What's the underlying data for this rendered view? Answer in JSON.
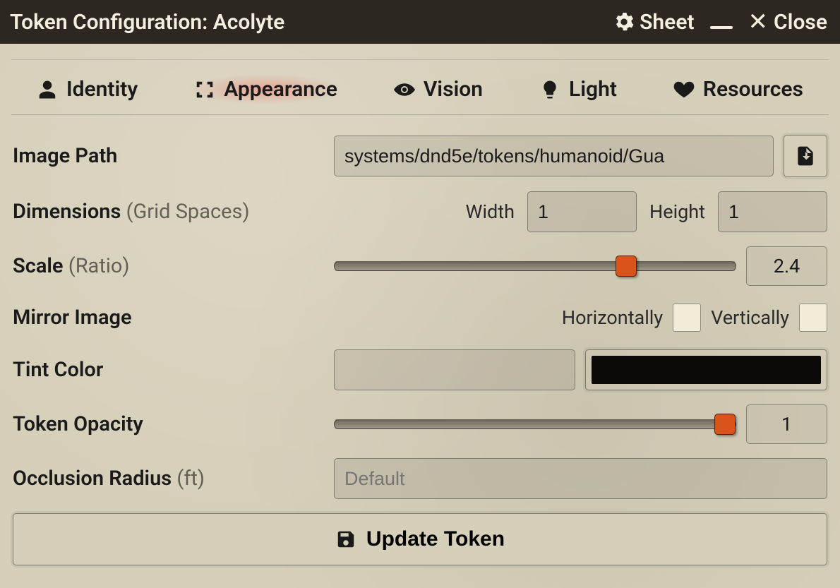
{
  "titlebar": {
    "title": "Token Configuration: Acolyte",
    "sheet_label": "Sheet",
    "close_label": "Close"
  },
  "tabs": {
    "identity": "Identity",
    "appearance": "Appearance",
    "vision": "Vision",
    "light": "Light",
    "resources": "Resources"
  },
  "labels": {
    "image_path": "Image Path",
    "dimensions": "Dimensions",
    "dimensions_hint": "(Grid Spaces)",
    "width": "Width",
    "height": "Height",
    "scale": "Scale",
    "scale_hint": "(Ratio)",
    "mirror": "Mirror Image",
    "horizontally": "Horizontally",
    "vertically": "Vertically",
    "tint": "Tint Color",
    "opacity": "Token Opacity",
    "occlusion": "Occlusion Radius",
    "occlusion_hint": "(ft)"
  },
  "values": {
    "image_path": "systems/dnd5e/tokens/humanoid/Gua",
    "width": "1",
    "height": "1",
    "scale": "2.4",
    "scale_slider": 74,
    "mirror_h": false,
    "mirror_v": false,
    "tint_text": "",
    "tint_color": "#0a0907",
    "opacity": "1",
    "opacity_slider": 100,
    "occlusion_placeholder": "Default",
    "occlusion_value": ""
  },
  "buttons": {
    "update": "Update Token"
  }
}
